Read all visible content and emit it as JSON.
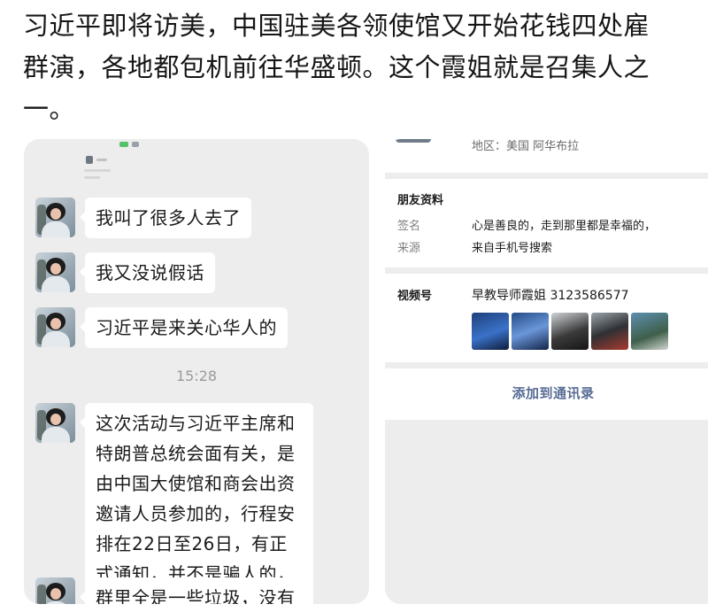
{
  "post": {
    "text": "习近平即将访美，中国驻美各领使馆又开始花钱四处雇群演，各地都包机前往华盛顿。这个霞姐就是召集人之一。"
  },
  "chat": {
    "messages": [
      "我叫了很多人去了",
      "我又没说假话",
      "习近平是来关心华人的"
    ],
    "timestamp": "15:28",
    "long_message": {
      "lines": [
        "这次活动与习近平主席和",
        "特朗普总统会面有关，是",
        "由中国大使馆和商会出资",
        "邀请人员参加的，行程安",
        "排在22日至26日，有正",
        "式通知，并不是骗人的，"
      ]
    },
    "cut_message": "群里全是一些垃圾，没有"
  },
  "profile": {
    "region": "地区：美国 阿华布拉",
    "friend_info_title": "朋友资料",
    "signature_label": "签名",
    "signature_value": "心是善良的，走到那里都是幸福的，",
    "source_label": "来源",
    "source_value": "来自手机号搜索",
    "channels_label": "视频号",
    "channels_value": "早教导师霞姐 3123586577",
    "add_contact": "添加到通讯录"
  },
  "colors": {
    "chat_bg": "#ededed",
    "bubble_bg": "#ffffff",
    "link_blue": "#576b95"
  }
}
